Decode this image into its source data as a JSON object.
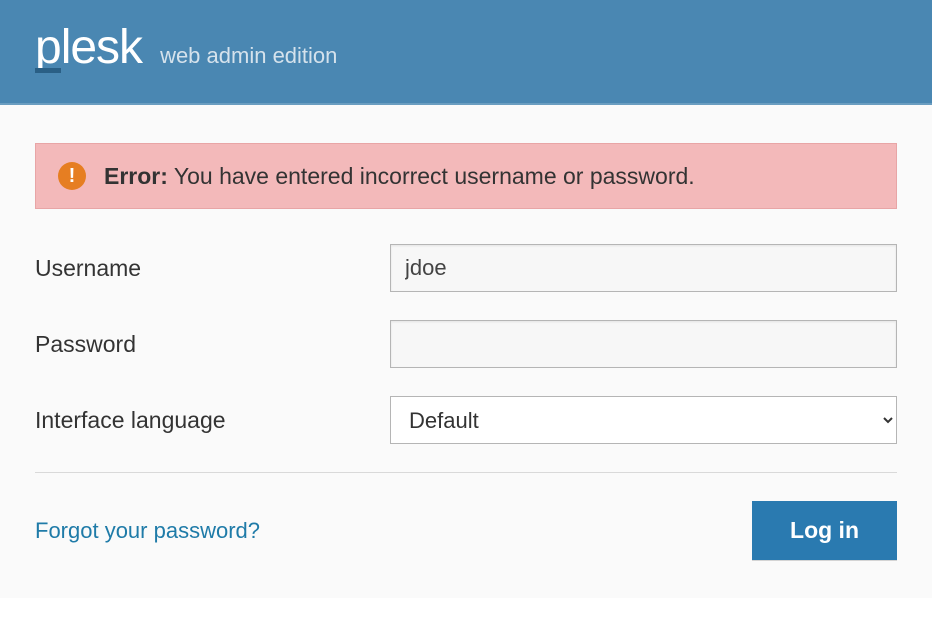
{
  "header": {
    "brand": "plesk",
    "subtitle": "web admin edition"
  },
  "error": {
    "label": "Error:",
    "message": " You have entered incorrect username or password."
  },
  "form": {
    "username": {
      "label": "Username",
      "value": "jdoe"
    },
    "password": {
      "label": "Password",
      "value": ""
    },
    "language": {
      "label": "Interface language",
      "selected": "Default"
    }
  },
  "footer": {
    "forgot_link": "Forgot your password?",
    "login_button": "Log in"
  }
}
